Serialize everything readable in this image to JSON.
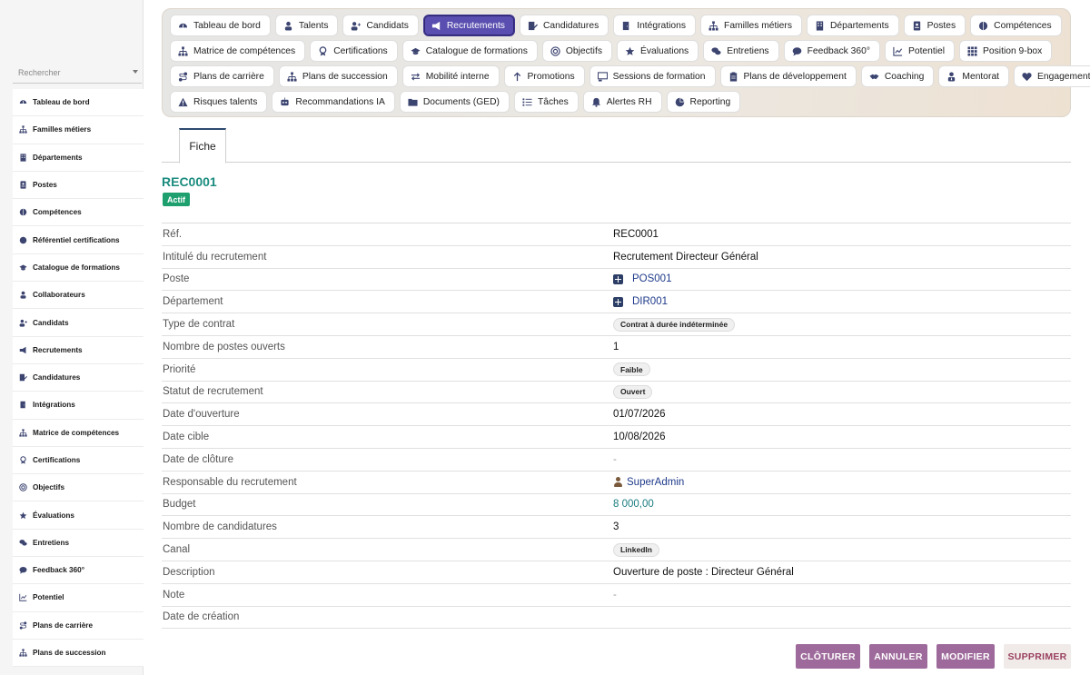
{
  "sidebar": {
    "search_placeholder": "Rechercher",
    "items": [
      {
        "label": "Tableau de bord",
        "icon": "dashboard-icon"
      },
      {
        "label": "Familles métiers",
        "icon": "sitemap-icon"
      },
      {
        "label": "Départements",
        "icon": "building-icon"
      },
      {
        "label": "Postes",
        "icon": "id-card-icon"
      },
      {
        "label": "Compétences",
        "icon": "brain-icon"
      },
      {
        "label": "Référentiel certifications",
        "icon": "certificate-icon"
      },
      {
        "label": "Catalogue de formations",
        "icon": "graduation-cap-icon"
      },
      {
        "label": "Collaborateurs",
        "icon": "user-icon"
      },
      {
        "label": "Candidats",
        "icon": "user-plus-icon"
      },
      {
        "label": "Recrutements",
        "icon": "megaphone-icon"
      },
      {
        "label": "Candidatures",
        "icon": "file-pen-icon"
      },
      {
        "label": "Intégrations",
        "icon": "door-icon"
      },
      {
        "label": "Matrice de compétences",
        "icon": "sitemap-icon"
      },
      {
        "label": "Certifications",
        "icon": "award-icon"
      },
      {
        "label": "Objectifs",
        "icon": "target-icon"
      },
      {
        "label": "Évaluations",
        "icon": "star-icon"
      },
      {
        "label": "Entretiens",
        "icon": "comments-icon"
      },
      {
        "label": "Feedback 360°",
        "icon": "comment-icon"
      },
      {
        "label": "Potentiel",
        "icon": "chart-line-icon"
      },
      {
        "label": "Plans de carrière",
        "icon": "route-icon"
      },
      {
        "label": "Plans de succession",
        "icon": "sitemap-icon"
      }
    ]
  },
  "nav": {
    "rows": [
      [
        {
          "label": "Tableau de bord",
          "icon": "dashboard-icon"
        },
        {
          "label": "Talents",
          "icon": "user-icon"
        },
        {
          "label": "Candidats",
          "icon": "user-plus-icon"
        },
        {
          "label": "Recrutements",
          "icon": "megaphone-icon",
          "active": true
        },
        {
          "label": "Candidatures",
          "icon": "file-pen-icon"
        },
        {
          "label": "Intégrations",
          "icon": "door-icon"
        },
        {
          "label": "Familles métiers",
          "icon": "sitemap-icon"
        },
        {
          "label": "Départements",
          "icon": "building-icon"
        },
        {
          "label": "Postes",
          "icon": "id-card-icon"
        },
        {
          "label": "Compétences",
          "icon": "brain-icon"
        }
      ],
      [
        {
          "label": "Matrice de compétences",
          "icon": "sitemap-icon"
        },
        {
          "label": "Certifications",
          "icon": "award-icon"
        },
        {
          "label": "Catalogue de formations",
          "icon": "graduation-cap-icon"
        },
        {
          "label": "Objectifs",
          "icon": "target-icon"
        },
        {
          "label": "Évaluations",
          "icon": "star-icon"
        },
        {
          "label": "Entretiens",
          "icon": "comments-icon"
        },
        {
          "label": "Feedback 360°",
          "icon": "comment-icon"
        },
        {
          "label": "Potentiel",
          "icon": "chart-line-icon"
        },
        {
          "label": "Position 9-box",
          "icon": "grid-icon"
        }
      ],
      [
        {
          "label": "Plans de carrière",
          "icon": "route-icon"
        },
        {
          "label": "Plans de succession",
          "icon": "sitemap-icon"
        },
        {
          "label": "Mobilité interne",
          "icon": "arrows-icon"
        },
        {
          "label": "Promotions",
          "icon": "arrow-up-icon"
        },
        {
          "label": "Sessions de formation",
          "icon": "chalkboard-icon"
        },
        {
          "label": "Plans de développement",
          "icon": "clipboard-icon"
        },
        {
          "label": "Coaching",
          "icon": "handshake-icon"
        },
        {
          "label": "Mentorat",
          "icon": "user-tie-icon"
        },
        {
          "label": "Engagement",
          "icon": "heart-icon"
        }
      ],
      [
        {
          "label": "Risques talents",
          "icon": "warning-icon"
        },
        {
          "label": "Recommandations IA",
          "icon": "robot-icon"
        },
        {
          "label": "Documents (GED)",
          "icon": "folder-icon"
        },
        {
          "label": "Tâches",
          "icon": "list-icon"
        },
        {
          "label": "Alertes RH",
          "icon": "bell-icon"
        },
        {
          "label": "Reporting",
          "icon": "pie-icon"
        }
      ]
    ]
  },
  "tab": {
    "label": "Fiche"
  },
  "record": {
    "ref": "REC0001",
    "status": "Actif"
  },
  "details": [
    {
      "label": "Réf.",
      "value": "REC0001",
      "type": "text"
    },
    {
      "label": "Intitulé du recrutement",
      "value": "Recrutement Directeur Général",
      "type": "text"
    },
    {
      "label": "Poste",
      "value": "POS001",
      "type": "link-building"
    },
    {
      "label": "Département",
      "value": "DIR001",
      "type": "link-building"
    },
    {
      "label": "Type de contrat",
      "value": "Contrat à durée indéterminée",
      "type": "badge"
    },
    {
      "label": "Nombre de postes ouverts",
      "value": "1",
      "type": "text"
    },
    {
      "label": "Priorité",
      "value": "Faible",
      "type": "badge"
    },
    {
      "label": "Statut de recrutement",
      "value": "Ouvert",
      "type": "badge"
    },
    {
      "label": "Date d'ouverture",
      "value": "01/07/2026",
      "type": "text"
    },
    {
      "label": "Date cible",
      "value": "10/08/2026",
      "type": "text"
    },
    {
      "label": "Date de clôture",
      "value": "-",
      "type": "dash"
    },
    {
      "label": "Responsable du recrutement",
      "value": "SuperAdmin",
      "type": "link-user"
    },
    {
      "label": "Budget",
      "value": "8 000,00",
      "type": "teal"
    },
    {
      "label": "Nombre de candidatures",
      "value": "3",
      "type": "text"
    },
    {
      "label": "Canal",
      "value": "LinkedIn",
      "type": "badge"
    },
    {
      "label": "Description",
      "value": "Ouverture de poste : Directeur Général",
      "type": "text"
    },
    {
      "label": "Note",
      "value": "-",
      "type": "dash"
    },
    {
      "label": "Date de création",
      "value": "",
      "type": "text"
    }
  ],
  "actions": {
    "close": "CLÔTURER",
    "cancel": "ANNULER",
    "edit": "MODIFIER",
    "delete": "SUPPRIMER"
  },
  "colors": {
    "accent_teal": "#1a8c7e",
    "active_nav": "#5a4fb0",
    "action_purple": "#9e6a9b",
    "status_green": "#1e9f6e"
  }
}
